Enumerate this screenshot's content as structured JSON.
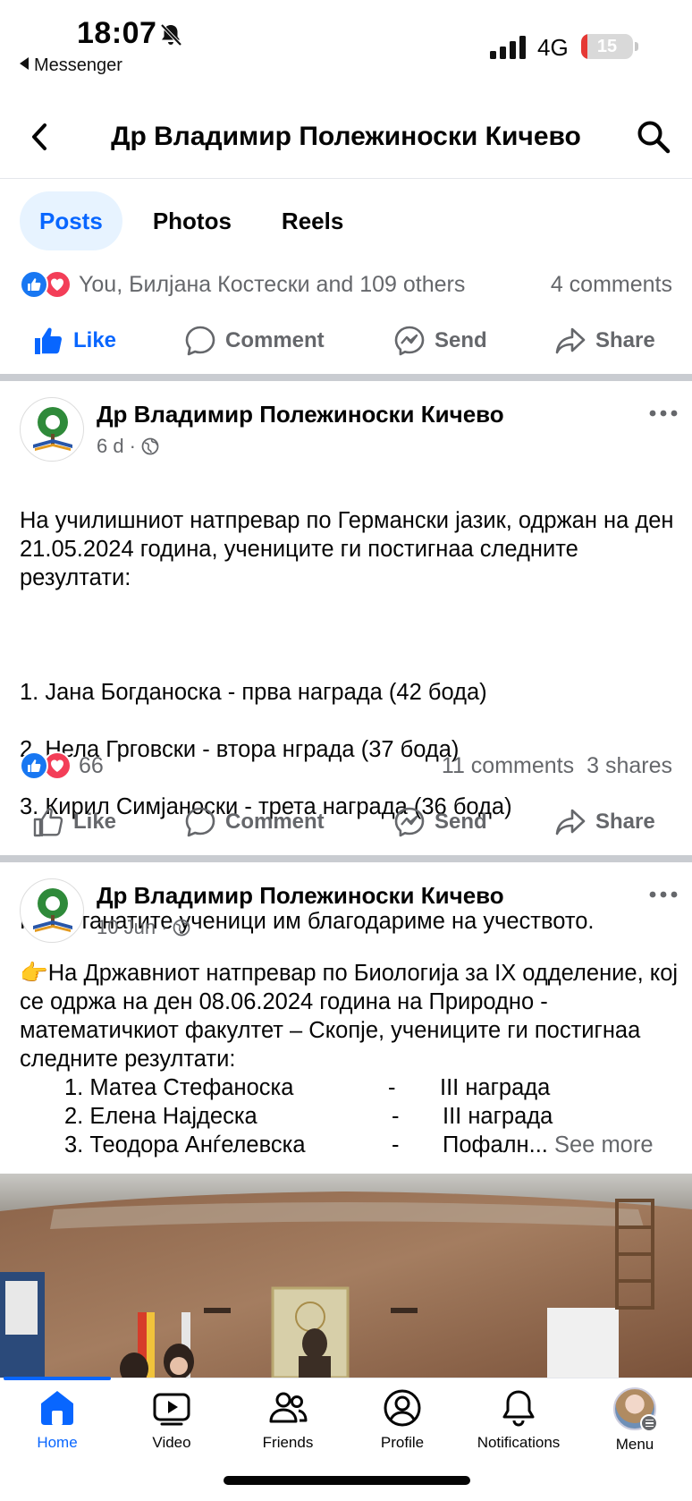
{
  "status_bar": {
    "time": "18:07",
    "back_app": "Messenger",
    "network": "4G",
    "battery": "15",
    "icons": [
      "bell-slash-icon",
      "signal-icon",
      "battery-icon"
    ]
  },
  "header": {
    "title": "Др Владимир Полежиноски Кичево",
    "icons": [
      "back-chevron-icon",
      "search-icon"
    ]
  },
  "tabs": [
    {
      "label": "Posts",
      "active": true
    },
    {
      "label": "Photos",
      "active": false
    },
    {
      "label": "Reels",
      "active": false
    }
  ],
  "top_reactions": {
    "text": "You, Билјана Костески and 109 others",
    "comments": "4 comments"
  },
  "actions": {
    "like": "Like",
    "comment": "Comment",
    "send": "Send",
    "share": "Share"
  },
  "posts": [
    {
      "author": "Др Владимир Полежиноски Кичево",
      "time": "6 d",
      "privacy_icon": "globe-icon",
      "intro": "На училишниот натпревар по Германски јазик, одржан на ден 21.05.2024 година,  учениците ги постигнаа следните резултати:",
      "results": [
        "1. Јана Богданоска - прва награда (42 бода)",
        "2. Нела Грговски - втора нграда (37 бода)",
        "3. Кирил Симјаноски - трета награда (36 бода)"
      ],
      "closing": "На останатите ученици им благодариме на учеството.",
      "reactions_count": "66",
      "comments": "11 comments",
      "shares": "3 shares"
    },
    {
      "author": "Др Владимир Полежиноски Кичево",
      "time": "10 Jun",
      "privacy_icon": "globe-icon",
      "emoji": "👉",
      "intro": "На Државниот натпревар по Биологија за IX одделение, кој се одржа на ден 08.06.2024 година на Природно - математичкиот факултет – Скопје, учениците ги  постигнаа следните резултати:",
      "results": [
        {
          "name": "1. Матеа Стефаноска",
          "dash": "-",
          "award": "III награда"
        },
        {
          "name": "2. Елена Најдеска",
          "dash": "-",
          "award": "III награда"
        },
        {
          "name": "3. Теодора  Анѓелевска",
          "dash": "-",
          "award": "Пофалн..."
        }
      ],
      "see_more": "See more"
    }
  ],
  "bottom_nav": [
    {
      "label": "Home",
      "icon": "home-icon",
      "active": true
    },
    {
      "label": "Video",
      "icon": "video-icon",
      "active": false
    },
    {
      "label": "Friends",
      "icon": "friends-icon",
      "active": false
    },
    {
      "label": "Profile",
      "icon": "profile-icon",
      "active": false
    },
    {
      "label": "Notifications",
      "icon": "bell-icon",
      "active": false
    },
    {
      "label": "Menu",
      "icon": "menu-avatar",
      "active": false
    }
  ],
  "colors": {
    "accent": "#0866ff",
    "secondary_text": "#65676b",
    "like_blue": "#1877f2",
    "love_red": "#f33e58",
    "divider": "#c9ccd1"
  }
}
